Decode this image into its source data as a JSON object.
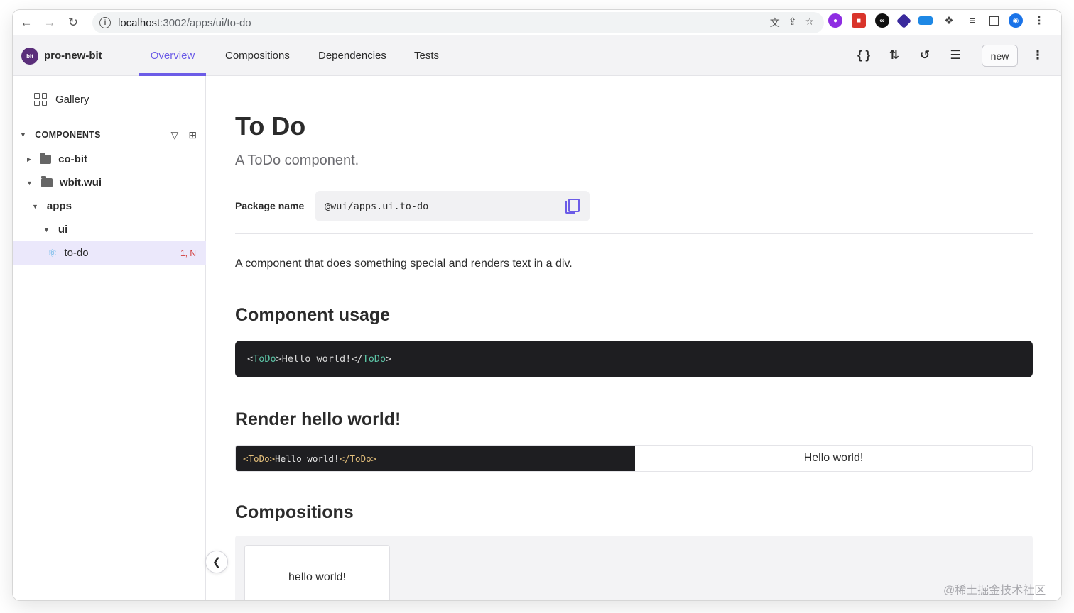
{
  "browser": {
    "url_host": "localhost",
    "url_rest": ":3002/apps/ui/to-do",
    "extensions": [
      {
        "icon": "translate-icon"
      },
      {
        "icon": "share-icon"
      },
      {
        "icon": "bookmark-star-icon"
      }
    ]
  },
  "header": {
    "logo_text": "bit",
    "scope_name": "pro-new-bit",
    "tabs": [
      {
        "label": "Overview",
        "active": true
      },
      {
        "label": "Compositions",
        "active": false
      },
      {
        "label": "Dependencies",
        "active": false
      },
      {
        "label": "Tests",
        "active": false
      }
    ],
    "icons": [
      "code-braces-icon",
      "compare-icon",
      "history-icon",
      "settings-sliders-icon"
    ],
    "version_label": "new",
    "accent_color": "#6c5ce7"
  },
  "sidebar": {
    "gallery_label": "Gallery",
    "components_title": "COMPONENTS",
    "tree": [
      {
        "label": "co-bit",
        "type": "scope",
        "expanded": false
      },
      {
        "label": "wbit.wui",
        "type": "scope",
        "expanded": true
      },
      {
        "label": "apps",
        "type": "namespace",
        "expanded": true
      },
      {
        "label": "ui",
        "type": "namespace",
        "expanded": true
      },
      {
        "label": "to-do",
        "type": "component",
        "status": "1, N",
        "selected": true
      }
    ]
  },
  "main": {
    "title": "To Do",
    "description": "A ToDo component.",
    "package_label": "Package name",
    "package_name": "@wui/apps.ui.to-do",
    "body_text": "A component that does something special and renders text in a div.",
    "usage_heading": "Component usage",
    "usage_code": {
      "open_lt": "<",
      "tag": "ToDo",
      "mid": ">Hello world!</",
      "close_gt": ">"
    },
    "render_heading": "Render hello world!",
    "render_code": {
      "open": "<ToDo>",
      "text": "Hello world!",
      "close": "</ToDo>"
    },
    "render_output": "Hello world!",
    "compositions_heading": "Compositions",
    "composition_card_text": "hello world!"
  },
  "watermark": "@稀土掘金技术社区"
}
